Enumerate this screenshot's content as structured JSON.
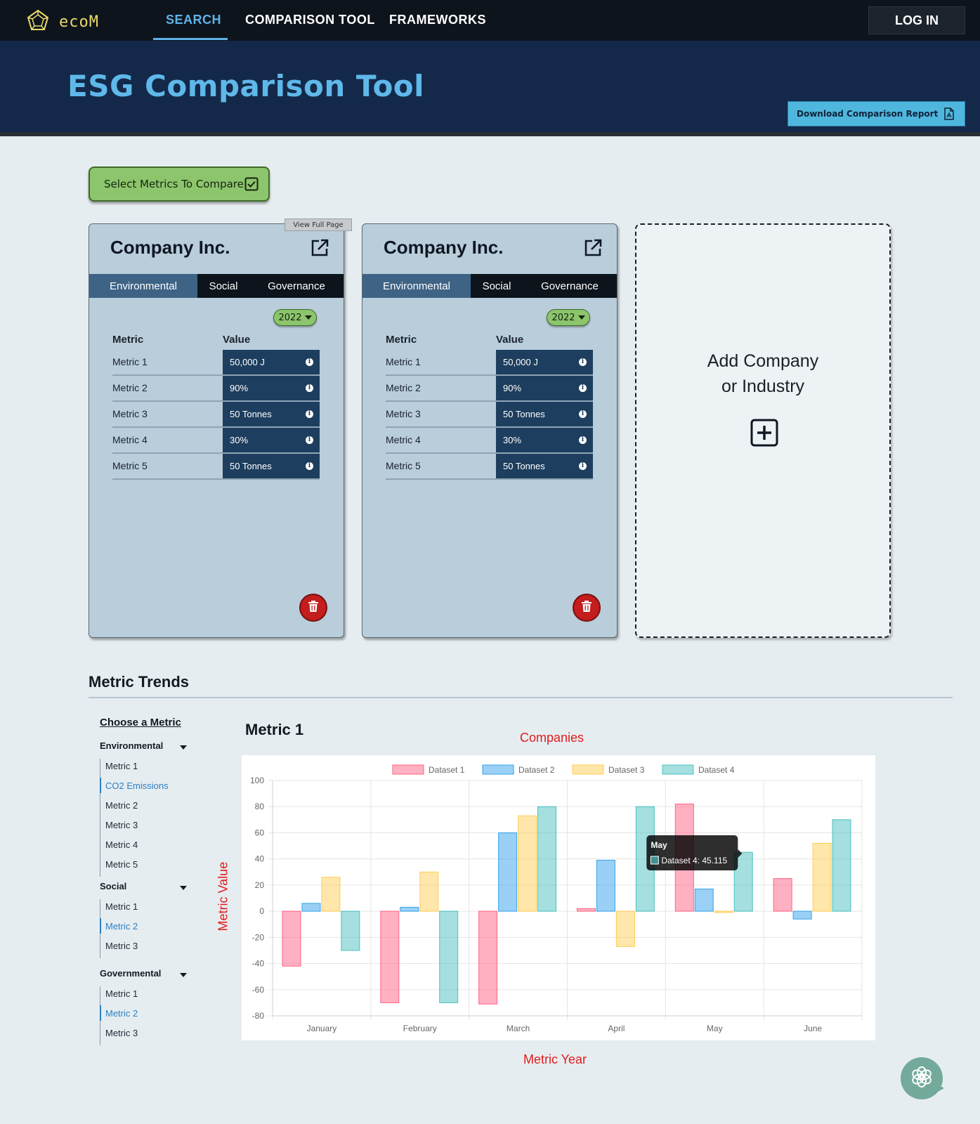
{
  "nav": {
    "logo_text": "ecoM",
    "links": [
      "SEARCH",
      "COMPARISON TOOL",
      "FRAMEWORKS"
    ],
    "login_label": "LOG IN"
  },
  "hero": {
    "title": "ESG Comparison Tool",
    "download_label": "Download Comparison Report"
  },
  "select_metrics_label": "Select Metrics To Compare",
  "view_full_page_tooltip": "View Full Page",
  "cards": [
    {
      "name": "Company Inc.",
      "tabs": [
        "Environmental",
        "Social",
        "Governance"
      ],
      "year": "2022",
      "col_metric": "Metric",
      "col_value": "Value",
      "rows": [
        {
          "metric": "Metric 1",
          "value": "50,000 J"
        },
        {
          "metric": "Metric 2",
          "value": "90%"
        },
        {
          "metric": "Metric 3",
          "value": "50 Tonnes"
        },
        {
          "metric": "Metric 4",
          "value": "30%"
        },
        {
          "metric": "Metric 5",
          "value": "50 Tonnes"
        }
      ]
    },
    {
      "name": "Company Inc.",
      "tabs": [
        "Environmental",
        "Social",
        "Governance"
      ],
      "year": "2022",
      "col_metric": "Metric",
      "col_value": "Value",
      "rows": [
        {
          "metric": "Metric 1",
          "value": "50,000 J"
        },
        {
          "metric": "Metric 2",
          "value": "90%"
        },
        {
          "metric": "Metric 3",
          "value": "50 Tonnes"
        },
        {
          "metric": "Metric 4",
          "value": "30%"
        },
        {
          "metric": "Metric 5",
          "value": "50 Tonnes"
        }
      ]
    }
  ],
  "add_card": {
    "line1": "Add Company",
    "line2": "or Industry"
  },
  "trends": {
    "title": "Metric Trends",
    "choose_label": "Choose a Metric",
    "groups": [
      {
        "name": "Environmental",
        "items": [
          "Metric 1",
          "CO2 Emissions",
          "Metric 2",
          "Metric 3",
          "Metric 4",
          "Metric 5"
        ],
        "selected": 1
      },
      {
        "name": "Social",
        "items": [
          "Metric 1",
          "Metric 2",
          "Metric 3"
        ],
        "selected": 1
      },
      {
        "name": "Governmental",
        "items": [
          "Metric 1",
          "Metric 2",
          "Metric 3"
        ],
        "selected": 1
      }
    ],
    "chart_heading": "Metric 1",
    "companies_label": "Companies",
    "y_axis_label": "Metric Value",
    "x_axis_label": "Metric Year"
  },
  "chart_data": {
    "type": "bar",
    "categories": [
      "January",
      "February",
      "March",
      "April",
      "May",
      "June"
    ],
    "series": [
      {
        "name": "Dataset 1",
        "values": [
          -42,
          -70,
          -71,
          2,
          82,
          25
        ],
        "color": "#ff6384"
      },
      {
        "name": "Dataset 2",
        "values": [
          6,
          3,
          60,
          39,
          17,
          -6
        ],
        "color": "#36a2eb"
      },
      {
        "name": "Dataset 3",
        "values": [
          26,
          30,
          73,
          -27,
          -1,
          52
        ],
        "color": "#ffcd56"
      },
      {
        "name": "Dataset 4",
        "values": [
          -30,
          -70,
          80,
          80,
          45.115,
          70
        ],
        "color": "#4bc0c0"
      }
    ],
    "ylim": [
      -80,
      100
    ],
    "yticks": [
      100,
      80,
      60,
      40,
      20,
      0,
      -20,
      -40,
      -60,
      -80
    ],
    "grid": true,
    "legend": "top",
    "tooltip": {
      "title": "May",
      "text": "Dataset 4: 45.115"
    }
  },
  "colors": {
    "nav_bg": "#0e141c",
    "hero_bg": "#14294a",
    "accent_blue": "#5fb8ea",
    "green_button": "#8cc56c",
    "card_bg": "#b9cddb",
    "value_cell": "#1d3e5e",
    "delete_red": "#c31d1d",
    "annotation_red": "#e21b1b"
  }
}
